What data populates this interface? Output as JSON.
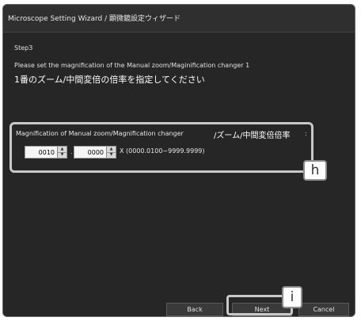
{
  "window": {
    "title": "Microscope Setting Wizard / 顕微鏡設定ウィザード"
  },
  "step": "Step3",
  "instructions": {
    "en": "Please set the magnification of the Manual zoom/Maginification changer 1",
    "jp": "1番のズーム/中間変倍の倍率を指定してください"
  },
  "group": {
    "title_en": "Magnification of Manual zoom/Magnification changer",
    "title_jp": "/ズーム/中間変倍倍率",
    "colon": ":"
  },
  "spin_integer": {
    "value": "0010",
    "up": "▲",
    "down": "▼"
  },
  "separator": ".",
  "spin_decimal": {
    "value": "0000",
    "up": "▲",
    "down": "▼"
  },
  "range_text": "X (0000.0100~9999.9999)",
  "buttons": {
    "back": "Back",
    "next": "Next",
    "cancel": "Cancel"
  },
  "callouts": {
    "h": "h",
    "i": "i"
  }
}
